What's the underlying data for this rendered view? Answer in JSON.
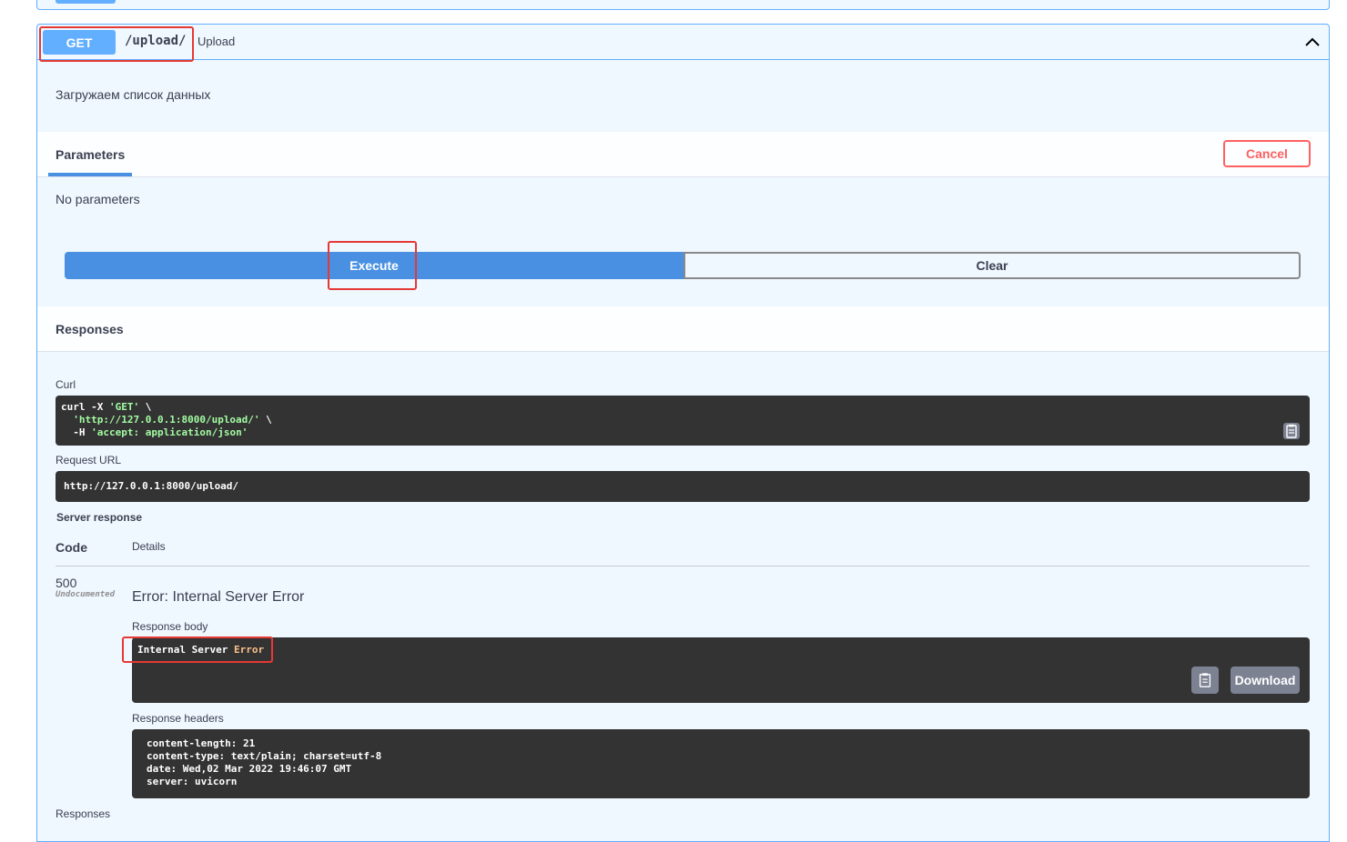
{
  "endpoint": {
    "method": "GET",
    "path": "/upload/",
    "summary": "Upload",
    "description": "Загружаем список данных",
    "colors": {
      "method": "#61affe",
      "execute": "#4990e2",
      "cancel": "#ff6060",
      "highlight": "#e53935"
    }
  },
  "parameters": {
    "tab_label": "Parameters",
    "cancel_label": "Cancel",
    "empty_text": "No parameters"
  },
  "actions": {
    "execute_label": "Execute",
    "clear_label": "Clear"
  },
  "responses": {
    "title": "Responses",
    "curl_label": "Curl",
    "curl": {
      "line1_cmd": "curl -X ",
      "line1_method": "'GET'",
      "line1_tail": " \\",
      "line2_url": "'http://127.0.0.1:8000/upload/'",
      "line2_tail": " \\",
      "line3_flag": "  -H ",
      "line3_header": "'accept: application/json'"
    },
    "request_url_label": "Request URL",
    "request_url": "http://127.0.0.1:8000/upload/",
    "server_response_label": "Server response",
    "code_header": "Code",
    "details_header": "Details",
    "code": "500",
    "undocumented": "Undocumented",
    "error_title": "Error: Internal Server Error",
    "response_body_label": "Response body",
    "response_body": {
      "word1": "Internal",
      "word2": "Server",
      "word3": "Error"
    },
    "download_label": "Download",
    "response_headers_label": "Response headers",
    "headers": [
      "content-length: 21",
      "content-type: text/plain; charset=utf-8",
      "date: Wed,02 Mar 2022 19:46:07 GMT",
      "server: uvicorn"
    ],
    "footer_label": "Responses"
  },
  "icons": {
    "collapse": "chevron-up-icon",
    "copy": "clipboard-copy-icon"
  }
}
